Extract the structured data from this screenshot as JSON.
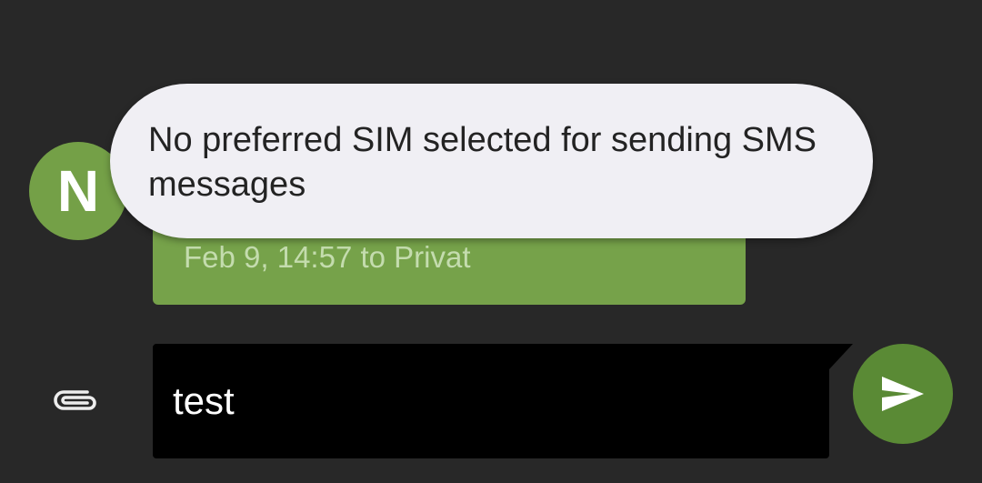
{
  "contact": {
    "avatar_letter": "N"
  },
  "message": {
    "meta": "Feb 9, 14:57 to Privat"
  },
  "toast": {
    "text": "No preferred SIM selected for sending SMS messages"
  },
  "compose": {
    "value": "test",
    "attach_icon": "paperclip-icon",
    "send_icon": "send-icon"
  },
  "colors": {
    "background": "#282828",
    "accent": "#74a047",
    "send_button": "#5a8a35",
    "toast_bg": "#f0eff4"
  }
}
